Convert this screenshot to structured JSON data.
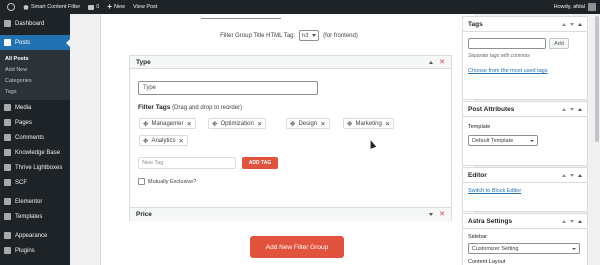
{
  "adminbar": {
    "site_name": "Smart Content Filter",
    "comments_count": "0",
    "new_label": "New",
    "view_post_label": "View Post",
    "howdy": "Howdy, afdal"
  },
  "sidebar": {
    "items": [
      {
        "label": "Dashboard",
        "icon": "dashboard-icon"
      },
      {
        "label": "Posts",
        "icon": "pin-icon"
      },
      {
        "label": "Media",
        "icon": "media-icon"
      },
      {
        "label": "Pages",
        "icon": "pages-icon"
      },
      {
        "label": "Comments",
        "icon": "comments-icon"
      },
      {
        "label": "Knowledge Base",
        "icon": "knowledge-base-icon"
      },
      {
        "label": "Thrive Lightboxes",
        "icon": "lightbox-icon"
      },
      {
        "label": "SCF",
        "icon": "scf-icon"
      },
      {
        "label": "Elementor",
        "icon": "elementor-icon"
      },
      {
        "label": "Templates",
        "icon": "templates-icon"
      },
      {
        "label": "Appearance",
        "icon": "appearance-icon"
      },
      {
        "label": "Plugins",
        "icon": "plugins-icon"
      }
    ],
    "posts_submenu": [
      "All Posts",
      "Add New",
      "Categories",
      "Tags"
    ]
  },
  "editor": {
    "title_tag_label": "Filter Group Title HTML Tag:",
    "title_tag_value": "h3",
    "title_tag_note": "(for frontend)",
    "groups": [
      {
        "title": "Type",
        "type_value": "Type",
        "filter_tags_label": "Filter Tags",
        "filter_tags_hint": "(Drag and drop to reorder)",
        "tags": [
          "Managemer",
          "Optimization",
          "Design",
          "Marketing",
          "Analytics"
        ],
        "new_tag_placeholder": "New Tag",
        "add_tag_label": "ADD TAG",
        "exclusive_label": "Mutually Exclusive?"
      },
      {
        "title": "Price"
      }
    ],
    "add_group_label": "Add New Filter Group"
  },
  "right": {
    "tags_box": {
      "title": "Tags",
      "add_label": "Add",
      "hint": "Separate tags with commas",
      "link": "Choose from the most used tags"
    },
    "post_attributes": {
      "title": "Post Attributes",
      "template_label": "Template",
      "template_value": "Default Template"
    },
    "editor_box": {
      "title": "Editor",
      "link": "Switch to Block Editor"
    },
    "astra": {
      "title": "Astra Settings",
      "sidebar_label": "Sidebar",
      "sidebar_value": "Customizer Setting",
      "content_layout_label": "Content Layout"
    }
  },
  "colors": {
    "accent": "#e2533e",
    "wp_blue": "#2271b1",
    "admin_dark": "#1d2327"
  }
}
